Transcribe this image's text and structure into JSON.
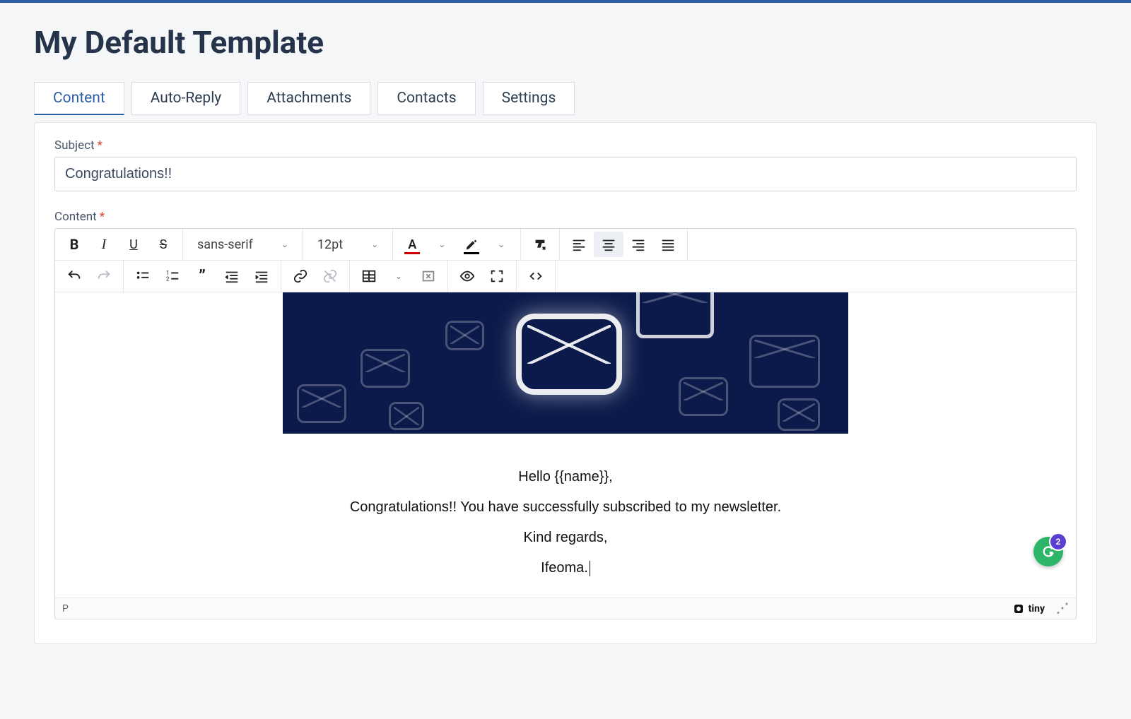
{
  "title": "My Default Template",
  "tabs": [
    "Content",
    "Auto-Reply",
    "Attachments",
    "Contacts",
    "Settings"
  ],
  "active_tab": 0,
  "form": {
    "subject_label": "Subject",
    "subject_value": "Congratulations!!",
    "content_label": "Content"
  },
  "toolbar": {
    "font_family": "sans-serif",
    "font_size": "12pt"
  },
  "body": {
    "greeting": "Hello {{name}},",
    "line2": "Congratulations!! You have successfully subscribed to my newsletter.",
    "signoff": "Kind regards,",
    "signature": "Ifeoma."
  },
  "statusbar": {
    "path": "P",
    "brand": "tiny"
  },
  "grammarly_count": "2"
}
